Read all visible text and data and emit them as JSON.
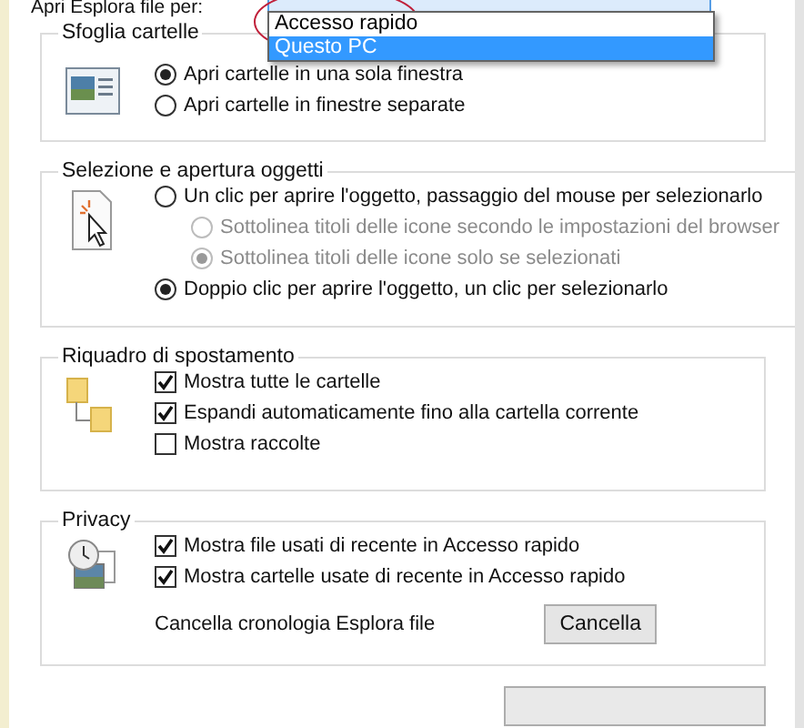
{
  "open_explorer": {
    "label": "Apri Esplora file per:",
    "options": [
      {
        "label": "Accesso rapido",
        "selected": false
      },
      {
        "label": "Questo PC",
        "selected": true
      }
    ]
  },
  "groups": [
    {
      "kind": "browse",
      "title": "Sfoglia cartelle",
      "options": [
        {
          "kind": "radio",
          "label": "Apri cartelle in una sola finestra",
          "selected": true,
          "disabled": false,
          "indent": false
        },
        {
          "kind": "radio",
          "label": "Apri cartelle in finestre separate",
          "selected": false,
          "disabled": false,
          "indent": false
        }
      ]
    },
    {
      "kind": "click",
      "title": "Selezione e apertura oggetti",
      "options": [
        {
          "kind": "radio",
          "label": "Un clic per aprire l'oggetto, passaggio del mouse per selezionarlo",
          "selected": false,
          "disabled": false,
          "indent": false
        },
        {
          "kind": "radio",
          "label": "Sottolinea titoli delle icone secondo le impostazioni del browser",
          "selected": false,
          "disabled": true,
          "indent": true
        },
        {
          "kind": "radio",
          "label": "Sottolinea titoli delle icone solo se selezionati",
          "selected": true,
          "disabled": true,
          "indent": true
        },
        {
          "kind": "radio",
          "label": "Doppio clic per aprire l'oggetto, un clic per selezionarlo",
          "selected": true,
          "disabled": false,
          "indent": false
        }
      ]
    },
    {
      "kind": "nav",
      "title": "Riquadro di spostamento",
      "options": [
        {
          "kind": "check",
          "label": "Mostra tutte le cartelle",
          "checked": true
        },
        {
          "kind": "check",
          "label": "Espandi automaticamente fino alla cartella corrente",
          "checked": true
        },
        {
          "kind": "check",
          "label": "Mostra raccolte",
          "checked": false
        }
      ]
    },
    {
      "kind": "privacy",
      "title": "Privacy",
      "options": [
        {
          "kind": "check",
          "label": "Mostra file usati di recente in Accesso rapido",
          "checked": true
        },
        {
          "kind": "check",
          "label": "Mostra cartelle usate di recente in Accesso rapido",
          "checked": true
        },
        {
          "kind": "action",
          "label": "Cancella cronologia Esplora file",
          "button": "Cancella"
        }
      ]
    }
  ]
}
